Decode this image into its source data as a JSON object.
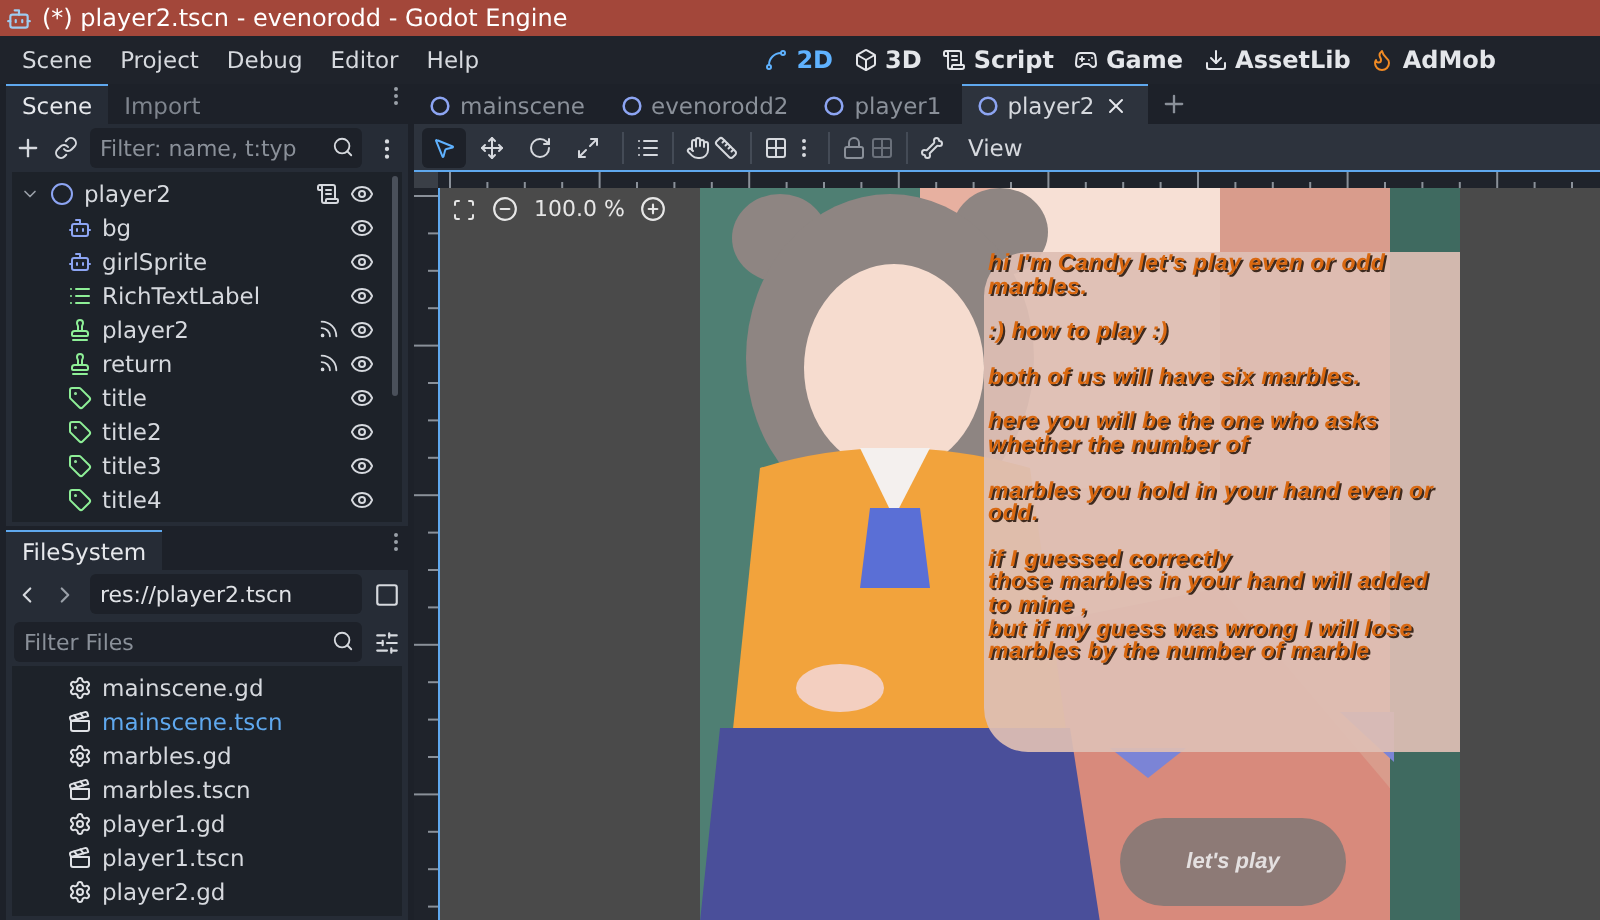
{
  "window": {
    "title": "(*) player2.tscn - evenorodd - Godot Engine"
  },
  "menus": [
    "Scene",
    "Project",
    "Debug",
    "Editor",
    "Help"
  ],
  "main_screens": [
    {
      "label": "2D",
      "kind": "planar",
      "selected": true
    },
    {
      "label": "3D",
      "kind": "spatial",
      "selected": false
    },
    {
      "label": "Script",
      "kind": "script",
      "selected": false
    },
    {
      "label": "Game",
      "kind": "game",
      "selected": false
    },
    {
      "label": "AssetLib",
      "kind": "assetlib",
      "selected": false
    },
    {
      "label": "AdMob",
      "kind": "admob",
      "selected": false
    }
  ],
  "scene_dock": {
    "tabs": [
      {
        "label": "Scene",
        "selected": true
      },
      {
        "label": "Import",
        "selected": false
      }
    ],
    "filter": {
      "placeholder": "Filter: name, t:typ"
    },
    "tree": {
      "name": "player2",
      "kind": "node",
      "expanded": true,
      "script": true,
      "children": [
        {
          "name": "bg",
          "kind": "sprite"
        },
        {
          "name": "girlSprite",
          "kind": "sprite"
        },
        {
          "name": "RichTextLabel",
          "kind": "richtext"
        },
        {
          "name": "player2",
          "kind": "button",
          "signals": true
        },
        {
          "name": "return",
          "kind": "button",
          "signals": true
        },
        {
          "name": "title",
          "kind": "label"
        },
        {
          "name": "title2",
          "kind": "label"
        },
        {
          "name": "title3",
          "kind": "label"
        },
        {
          "name": "title4",
          "kind": "label"
        }
      ]
    }
  },
  "filesystem": {
    "tab": "FileSystem",
    "path": "res://player2.tscn",
    "filter": {
      "placeholder": "Filter Files"
    },
    "files": [
      {
        "name": "mainscene.gd",
        "kind": "script",
        "selected": false
      },
      {
        "name": "mainscene.tscn",
        "kind": "scene",
        "selected": true
      },
      {
        "name": "marbles.gd",
        "kind": "script",
        "selected": false
      },
      {
        "name": "marbles.tscn",
        "kind": "scene",
        "selected": false
      },
      {
        "name": "player1.gd",
        "kind": "script",
        "selected": false
      },
      {
        "name": "player1.tscn",
        "kind": "scene",
        "selected": false
      },
      {
        "name": "player2.gd",
        "kind": "script",
        "selected": false
      }
    ]
  },
  "scene_tabs": [
    {
      "label": "mainscene",
      "selected": false
    },
    {
      "label": "evenorodd2",
      "selected": false
    },
    {
      "label": "player1",
      "selected": false
    },
    {
      "label": "player2",
      "selected": true
    }
  ],
  "toolbar": {
    "tools": [
      {
        "selected": true
      },
      {
        "selected": false
      },
      {
        "selected": false
      },
      {
        "selected": false
      }
    ],
    "view": "View"
  },
  "viewport": {
    "zoom": "100.0 %",
    "dialog": [
      [
        "hi I'm Candy let's play even or odd marbles."
      ],
      [
        ":) how to play :)"
      ],
      [
        "both of us will have six marbles."
      ],
      [
        "here you will be the one who asks whether the number of"
      ],
      [
        "marbles you hold in your hand even or odd."
      ],
      [
        "if I guessed correctly",
        "those marbles in your hand will added to mine ,",
        "but if my guess was wrong I will lose marbles by the number of marble"
      ]
    ],
    "button": "let's play"
  }
}
